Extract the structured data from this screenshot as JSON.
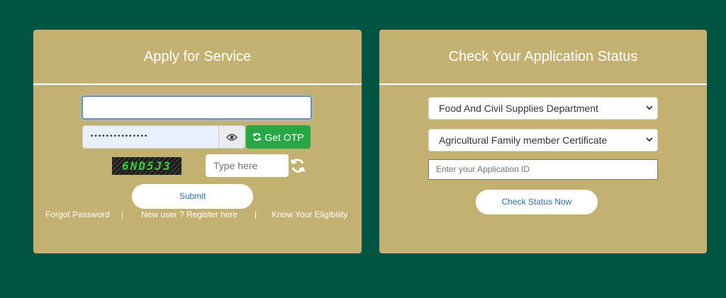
{
  "apply": {
    "title": "Apply for Service",
    "password_mask": "•••••••••••••••",
    "get_otp_label": "Get OTP",
    "captcha_text": "6ND5J3",
    "captcha_placeholder": "Type here",
    "submit_label": "Submit",
    "links": {
      "forgot_password": "Forgot Password",
      "separator": "|",
      "register": "New user ? Register here",
      "eligibility": "Know Your Eligibility"
    }
  },
  "status": {
    "title": "Check Your Application Status",
    "department_selected": "Food And Civil Supplies Department",
    "certificate_selected": "Agricultural Family member Certificate",
    "application_id_placeholder": "Enter your Application ID",
    "check_label": "Check Status Now"
  },
  "icons": {
    "eye": "eye-icon",
    "otp_refresh": "refresh-icon",
    "captcha_refresh": "refresh-icon",
    "chevron": "chevron-down-icon"
  },
  "colors": {
    "background": "#005442",
    "panel": "#c3b171",
    "otp_button": "#28a745",
    "link_text": "#2a6fb0"
  }
}
